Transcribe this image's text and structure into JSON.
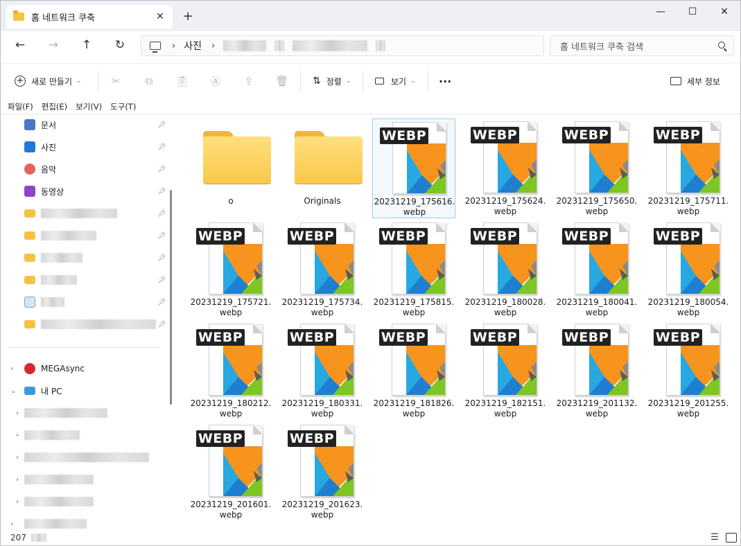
{
  "window": {
    "tab_title": "홈 네트워크 쿠축",
    "tab_close": "✕",
    "new_tab": "+",
    "minimize": "—",
    "maximize": "☐",
    "close": "✕"
  },
  "nav": {
    "back": "←",
    "forward": "→",
    "up": "↑",
    "refresh": "↻",
    "crumbs": [
      "사진"
    ],
    "search_placeholder": "홈 네트워크 쿠축 검색"
  },
  "toolbar": {
    "new_label": "새로 만들기",
    "sort_label": "정렬",
    "view_label": "보기",
    "more_label": "···",
    "details_label": "세부 정보",
    "new_icon": "plus-circle-icon",
    "cut_icon": "scissors-icon",
    "copy_icon": "copy-icon",
    "paste_icon": "paste-icon",
    "rename_icon": "rename-icon",
    "share_icon": "share-icon",
    "delete_icon": "trash-icon"
  },
  "menu": [
    "파일(F)",
    "편집(E)",
    "보기(V)",
    "도구(T)"
  ],
  "sidebar": {
    "quick": [
      {
        "label": "문서",
        "color": "#4a74c4"
      },
      {
        "label": "사진",
        "color": "#1f7ad6"
      },
      {
        "label": "음악",
        "color": "#e0655a"
      },
      {
        "label": "동영상",
        "color": "#8a46c9"
      }
    ],
    "mega": "MEGAsync",
    "pc": "내 PC",
    "status_count": "207"
  },
  "files": [
    {
      "type": "folder",
      "name1": "o",
      "name2": ""
    },
    {
      "type": "folder",
      "name1": "Originals",
      "name2": ""
    },
    {
      "type": "webp",
      "name1": "20231219_175616.",
      "name2": "webp",
      "selected": true
    },
    {
      "type": "webp",
      "name1": "20231219_175624.",
      "name2": "webp"
    },
    {
      "type": "webp",
      "name1": "20231219_175650.",
      "name2": "webp"
    },
    {
      "type": "webp",
      "name1": "20231219_175711.",
      "name2": "webp"
    },
    {
      "type": "webp",
      "name1": "20231219_175721.",
      "name2": "webp"
    },
    {
      "type": "webp",
      "name1": "20231219_175734.",
      "name2": "webp"
    },
    {
      "type": "webp",
      "name1": "20231219_175815.",
      "name2": "webp"
    },
    {
      "type": "webp",
      "name1": "20231219_180028.",
      "name2": "webp"
    },
    {
      "type": "webp",
      "name1": "20231219_180041.",
      "name2": "webp"
    },
    {
      "type": "webp",
      "name1": "20231219_180054.",
      "name2": "webp"
    },
    {
      "type": "webp",
      "name1": "20231219_180212.",
      "name2": "webp"
    },
    {
      "type": "webp",
      "name1": "20231219_180331.",
      "name2": "webp"
    },
    {
      "type": "webp",
      "name1": "20231219_181826.",
      "name2": "webp"
    },
    {
      "type": "webp",
      "name1": "20231219_182151.",
      "name2": "webp"
    },
    {
      "type": "webp",
      "name1": "20231219_201132.",
      "name2": "webp"
    },
    {
      "type": "webp",
      "name1": "20231219_201255.",
      "name2": "webp"
    },
    {
      "type": "webp",
      "name1": "20231219_201601.",
      "name2": "webp"
    },
    {
      "type": "webp",
      "name1": "20231219_201623.",
      "name2": "webp"
    }
  ],
  "webp_badge": "WEBP"
}
